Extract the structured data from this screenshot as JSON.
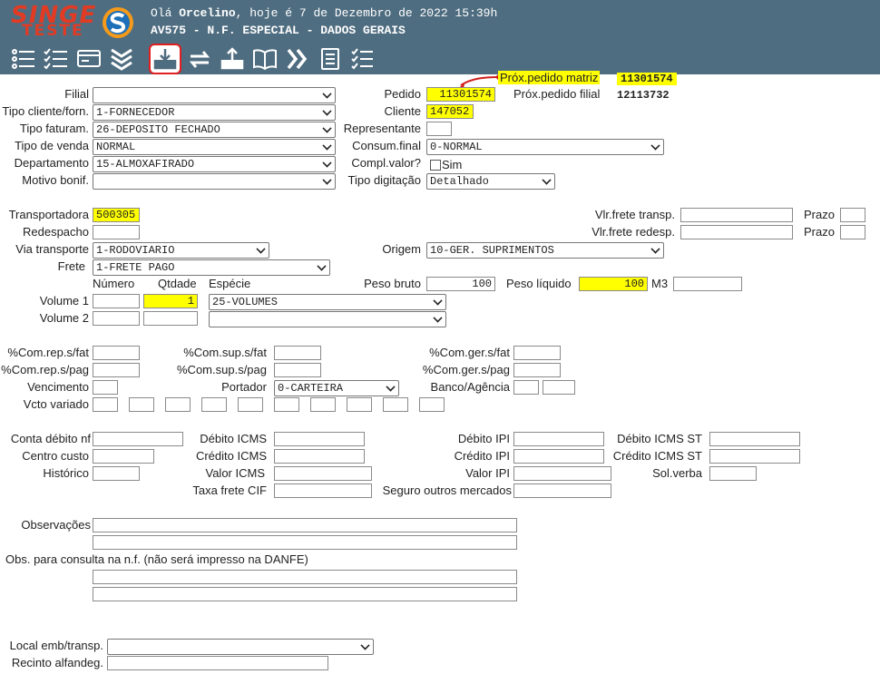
{
  "header": {
    "logo_text": "SINGE",
    "logo_sub": "TESTE",
    "greeting_prefix": "Olá ",
    "user": "Orcelino",
    "greeting_suffix": ", hoje é 7 de Dezembro de 2022 15:39h",
    "screen_title": "AV575 - N.F. ESPECIAL - DADOS GERAIS"
  },
  "toolbar": {
    "icons": [
      "list-icon",
      "checklist-icon",
      "card-icon",
      "chevrons-down-icon",
      "download-tray-icon",
      "sync-icon",
      "upload-tray-icon",
      "book-icon",
      "fast-forward-icon",
      "document-list-icon",
      "checklist-alt-icon"
    ]
  },
  "top": {
    "prox_matriz_label": "Próx.pedido matriz",
    "prox_matriz_value": "11301574",
    "prox_filial_label": "Próx.pedido filial",
    "prox_filial_value": "12113732"
  },
  "labels": {
    "filial": "Filial",
    "tipo_cliente": "Tipo cliente/forn.",
    "tipo_faturam": "Tipo faturam.",
    "tipo_venda": "Tipo de venda",
    "departamento": "Departamento",
    "motivo_bonif": "Motivo bonif.",
    "pedido": "Pedido",
    "cliente": "Cliente",
    "representante": "Representante",
    "consum_final": "Consum.final",
    "compl_valor": "Compl.valor?",
    "sim": "Sim",
    "tipo_digitacao": "Tipo digitação",
    "transportadora": "Transportadora",
    "redespacho": "Redespacho",
    "via_transporte": "Via transporte",
    "frete": "Frete",
    "vlr_frete_transp": "Vlr.frete transp.",
    "vlr_frete_redesp": "Vlr.frete redesp.",
    "prazo": "Prazo",
    "origem": "Origem",
    "numero": "Número",
    "qtdade": "Qtdade",
    "especie": "Espécie",
    "peso_bruto": "Peso bruto",
    "peso_liquido": "Peso líquido",
    "m3": "M3",
    "volume1": "Volume 1",
    "volume2": "Volume 2",
    "com_rep_fat": "%Com.rep.s/fat",
    "com_rep_pag": "%Com.rep.s/pag",
    "com_sup_fat": "%Com.sup.s/fat",
    "com_sup_pag": "%Com.sup.s/pag",
    "com_ger_fat": "%Com.ger.s/fat",
    "com_ger_pag": "%Com.ger.s/pag",
    "vencimento": "Vencimento",
    "portador": "Portador",
    "banco_agencia": "Banco/Agência",
    "vcto_variado": "Vcto variado",
    "conta_debito": "Conta débito nf",
    "centro_custo": "Centro custo",
    "historico": "Histórico",
    "debito_icms": "Débito ICMS",
    "credito_icms": "Crédito ICMS",
    "valor_icms": "Valor ICMS",
    "taxa_frete": "Taxa frete CIF",
    "debito_ipi": "Débito IPI",
    "credito_ipi": "Crédito IPI",
    "valor_ipi": "Valor IPI",
    "seguro": "Seguro outros mercados",
    "debito_icms_st": "Débito ICMS ST",
    "credito_icms_st": "Crédito ICMS ST",
    "sol_verba": "Sol.verba",
    "observacoes": "Observações",
    "obs_consulta": "Obs. para consulta na n.f. (não será impresso na DANFE)",
    "local_emb": "Local emb/transp.",
    "recinto": "Recinto alfandeg."
  },
  "values": {
    "filial": "",
    "tipo_cliente": "1-FORNECEDOR",
    "tipo_faturam": "26-DEPOSITO FECHADO",
    "tipo_venda": "NORMAL",
    "departamento": "15-ALMOXAFIRADO",
    "motivo_bonif": "",
    "pedido": "11301574",
    "cliente": "147052",
    "consum_final": "0-NORMAL",
    "tipo_digitacao": "Detalhado",
    "transportadora": "500305",
    "via_transporte": "1-RODOVIARIO",
    "frete": "1-FRETE PAGO",
    "origem": "10-GER. SUPRIMENTOS",
    "qtdade1": "1",
    "especie1": "25-VOLUMES",
    "peso_bruto": "100",
    "peso_liquido": "100",
    "portador": "0-CARTEIRA",
    "local_emb": ""
  }
}
